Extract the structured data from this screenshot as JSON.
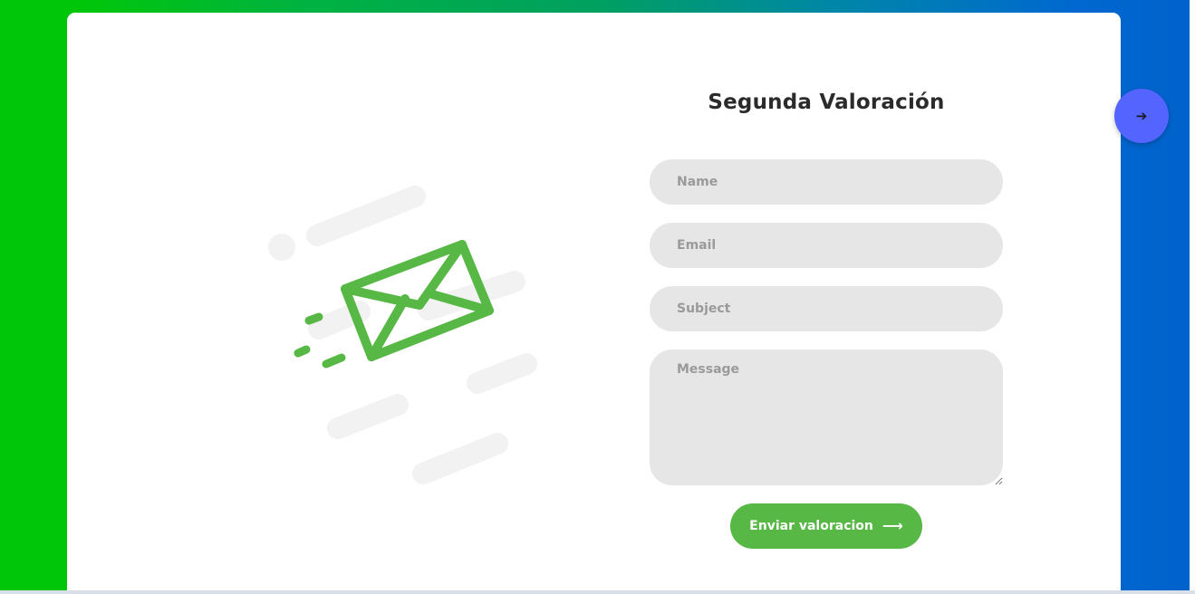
{
  "form": {
    "title": "Segunda Valoración",
    "name_placeholder": "Name",
    "email_placeholder": "Email",
    "subject_placeholder": "Subject",
    "message_placeholder": "Message",
    "submit_label": "Enviar valoracion",
    "submit_icon": "long-arrow-right-icon"
  },
  "fab": {
    "icon": "arrow-right-icon"
  },
  "illustration": {
    "icon": "envelope-icon",
    "color": "#57b846"
  },
  "colors": {
    "accent": "#57b846",
    "fab": "#5464ff",
    "input_bg": "#e6e6e6",
    "title": "#2b2b2b"
  }
}
